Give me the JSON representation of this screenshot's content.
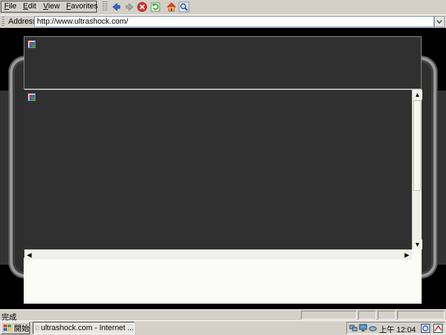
{
  "menubar": {
    "items": [
      {
        "label": "File",
        "accel": "F",
        "rest": "ile"
      },
      {
        "label": "Edit",
        "accel": "E",
        "rest": "dit"
      },
      {
        "label": "View",
        "accel": "V",
        "rest": "iew"
      },
      {
        "label": "Favorites",
        "accel": "F",
        "rest": "avorites"
      }
    ]
  },
  "toolbar": {
    "buttons": [
      "back-icon",
      "forward-icon",
      "stop-icon",
      "refresh-icon",
      "home-icon",
      "search-icon"
    ]
  },
  "address": {
    "label": "Address",
    "url": "http://www.ultrashock.com/"
  },
  "status": {
    "text": "完成"
  },
  "taskbar": {
    "start_label": "開始",
    "task_label": "ultrashock.com - Internet ...",
    "clock": "上午 12:04"
  },
  "colors": {
    "chrome": "#d4d0c8",
    "page_bg": "#000000",
    "panel": "#303030",
    "address_border": "#7f9db9"
  }
}
